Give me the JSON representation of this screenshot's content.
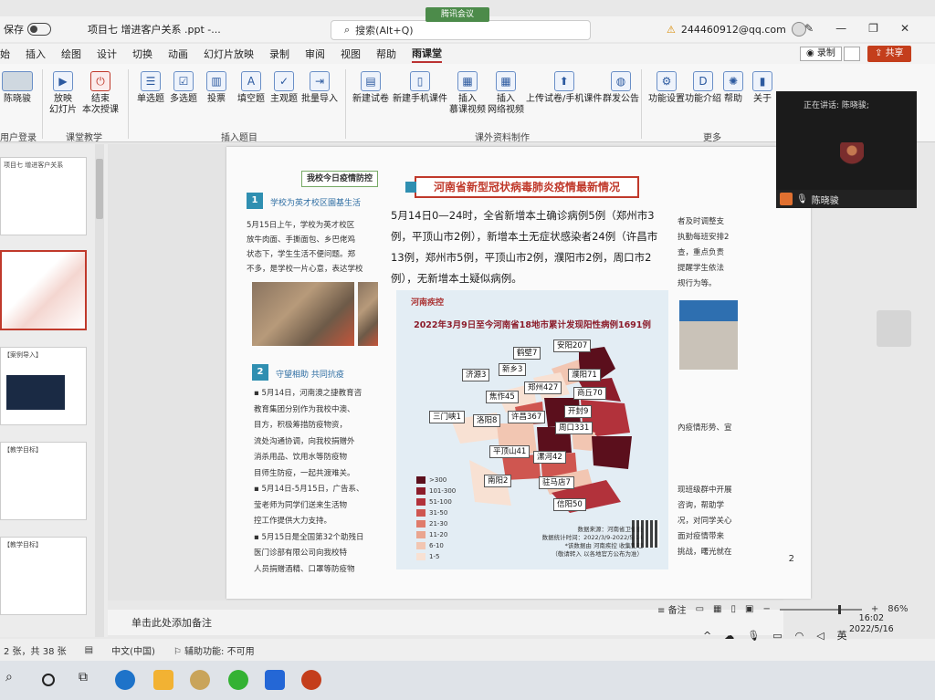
{
  "titlebar": {
    "autosave_label": "保存",
    "doc_title": "项目七 增进客户关系 .ppt  -...",
    "search_placeholder": "搜索(Alt+Q)",
    "meeting_badge": "腾讯会议",
    "account": "244460912@qq.com"
  },
  "ribbon_tabs": [
    "始",
    "插入",
    "绘图",
    "设计",
    "切换",
    "动画",
    "幻灯片放映",
    "录制",
    "审阅",
    "视图",
    "帮助",
    "雨课堂"
  ],
  "active_tab": "雨课堂",
  "actions": {
    "record": "录制",
    "share": "共享"
  },
  "ribbon": {
    "user_login_btn": "陈晓骏",
    "group_user": "用户登录",
    "play_btn": "放映\n幻灯片",
    "end_btn": "结束\n本次授课",
    "group_teach": "课堂教学",
    "insert_buttons": [
      "单选题",
      "多选题",
      "投票",
      "填空题",
      "主观题",
      "批量导入"
    ],
    "group_insert": "插入题目",
    "material_buttons": [
      "新建试卷",
      "新建手机课件",
      "插入\n慕课视频",
      "插入\n网络视频",
      "上传试卷/手机课件",
      "群发公告"
    ],
    "group_material": "课外资料制作",
    "more_buttons": [
      "功能设置",
      "功能介绍",
      "帮助",
      "关于"
    ],
    "group_more": "更多"
  },
  "thumbnails": [
    {
      "text": "项目七 增进客户关系"
    },
    {
      "text": ""
    },
    {
      "text": "【案例导入】"
    },
    {
      "text": "【教学目标】"
    },
    {
      "text": "【教学目标】"
    }
  ],
  "slide": {
    "heading": "我校今日疫情防控",
    "sec1_num": "1",
    "sec1_title": "学校为英才校区園基生活",
    "sec1_para": "5月15日上午，学校为英才校区\n放牛肉面、手撕面包、乡巴佬鸡\n状态下，学生生活不便问题。郑\n不多，是学校一片心意，表达学校",
    "sec2_num": "2",
    "sec2_title": "守望相助 共同抗疫",
    "sec2_para": "▪ 5月14日，河南澳之捷教育咨\n  教育集团分别作为我校中澳、\n  目方，积极筹措防疫物资，\n  流处沟通协调，向我校捐赠外\n  消杀用品、饮用水等防疫物\n  目师生防疫，一起共渡难关。\n▪ 5月14日-5月15日，广告系、\n  莹老师为同学们送来生活物\n  控工作提供大力支持。\n▪ 5月15日是全国第32个助残日\n  医门诊部有限公司向我校特\n  人员捐赠酒精、口罩等防疫物",
    "red_title": "河南省新型冠状病毒肺炎疫情最新情况",
    "big_text": "5月14日0—24时，全省新增本土确诊病例5例（郑州市3例，平顶山市2例），新增本土无症状感染者24例（许昌市13例，郑州市5例，平顶山市2例，濮阳市2例，周口市2例），无新增本土疑似病例。",
    "right_text_top": "者及时调整支\n执勤每班安排2\n查，重点负责\n提醒学生依法\n规行为等。",
    "right_text_bottom": "內疫情形势、宣\n\n\n\n现班级群中开展\n咨询，帮助学\n况，对同学关心\n面对疫情带来\n挑战，曙光就在",
    "slide_number": "2"
  },
  "map": {
    "logo": "河南疾控",
    "title": "2022年3月9日至今河南省18地市累计发现阳性病例1691例",
    "cities": [
      {
        "name": "鹤壁7"
      },
      {
        "name": "安阳207"
      },
      {
        "name": "新乡3"
      },
      {
        "name": "濮阳71"
      },
      {
        "name": "济源3"
      },
      {
        "name": "郑州427"
      },
      {
        "name": "焦作45"
      },
      {
        "name": "商丘70"
      },
      {
        "name": "开封9"
      },
      {
        "name": "三门峡1"
      },
      {
        "name": "洛阳8"
      },
      {
        "name": "许昌367"
      },
      {
        "name": "周口331"
      },
      {
        "name": "平顶山41"
      },
      {
        "name": "漯河42"
      },
      {
        "name": "南阳2"
      },
      {
        "name": "驻马店7"
      },
      {
        "name": "信阳50"
      }
    ],
    "legend": [
      {
        "label": ">300",
        "color": "#5b0f1c"
      },
      {
        "label": "101-300",
        "color": "#8c1d2b"
      },
      {
        "label": "51-100",
        "color": "#b2323b"
      },
      {
        "label": "31-50",
        "color": "#cf5650"
      },
      {
        "label": "21-30",
        "color": "#e07b6a"
      },
      {
        "label": "11-20",
        "color": "#eaa58f"
      },
      {
        "label": "6-10",
        "color": "#f2c6b2"
      },
      {
        "label": "1-5",
        "color": "#f8e1d3"
      }
    ],
    "source": "数据来源：河南省卫健委\n数据统计时间：2022/3/9-2022/5/14\n*该数据由 河南疾控 收集整理\n（敬请转入 以各地官方公布为准）"
  },
  "video": {
    "speaking_label": "正在讲话: 陈晓骏;",
    "name": "陈晓骏"
  },
  "notes_placeholder": "单击此处添加备注",
  "statusbar": {
    "slide_count": "2 张，共 38 张",
    "language": "中文(中国)",
    "accessibility": "辅助功能: 不可用",
    "notes_btn": "备注",
    "zoom": "86%"
  },
  "clock": {
    "time": "16:02",
    "date": "2022/5/16"
  },
  "tray_lang": "英"
}
